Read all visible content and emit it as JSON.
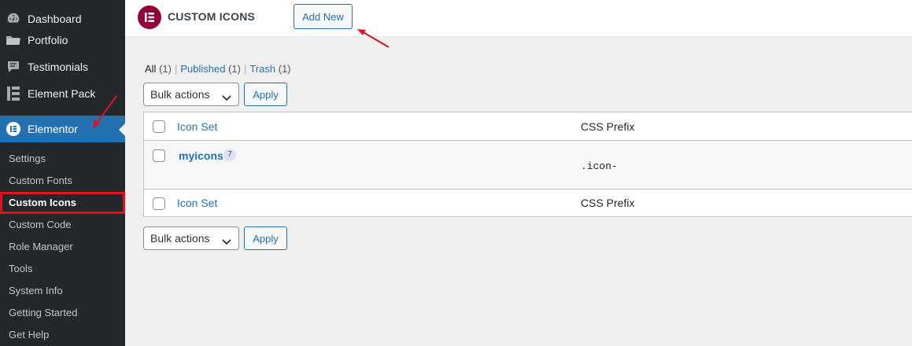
{
  "sidebar": {
    "items": [
      {
        "label": "Dashboard",
        "icon": "dashboard-icon"
      },
      {
        "label": "Portfolio",
        "icon": "portfolio-icon"
      },
      {
        "label": "Testimonials",
        "icon": "testimonials-icon"
      },
      {
        "label": "Element Pack",
        "icon": "element-pack-icon"
      },
      {
        "label": "Elementor",
        "icon": "elementor-icon"
      }
    ],
    "submenu": [
      "Settings",
      "Custom Fonts",
      "Custom Icons",
      "Custom Code",
      "Role Manager",
      "Tools",
      "System Info",
      "Getting Started",
      "Get Help"
    ]
  },
  "header": {
    "logo_letter": "E",
    "title": "CUSTOM ICONS",
    "add_new_label": "Add New"
  },
  "filters": {
    "all_label": "All",
    "all_count": "(1)",
    "published_label": "Published",
    "published_count": "(1)",
    "trash_label": "Trash",
    "trash_count": "(1)",
    "separator": "|"
  },
  "bulk": {
    "label": "Bulk actions",
    "apply_label": "Apply"
  },
  "table": {
    "columns": [
      "Icon Set",
      "CSS Prefix"
    ],
    "rows": [
      {
        "title": "myicons",
        "count": "7",
        "prefix": ".icon-"
      }
    ]
  },
  "colors": {
    "sidebar_bg": "#23282d",
    "active_bg": "#2271b1",
    "highlight_red": "#e5101f",
    "elementor_brand": "#92003b",
    "link": "#2271b1"
  }
}
